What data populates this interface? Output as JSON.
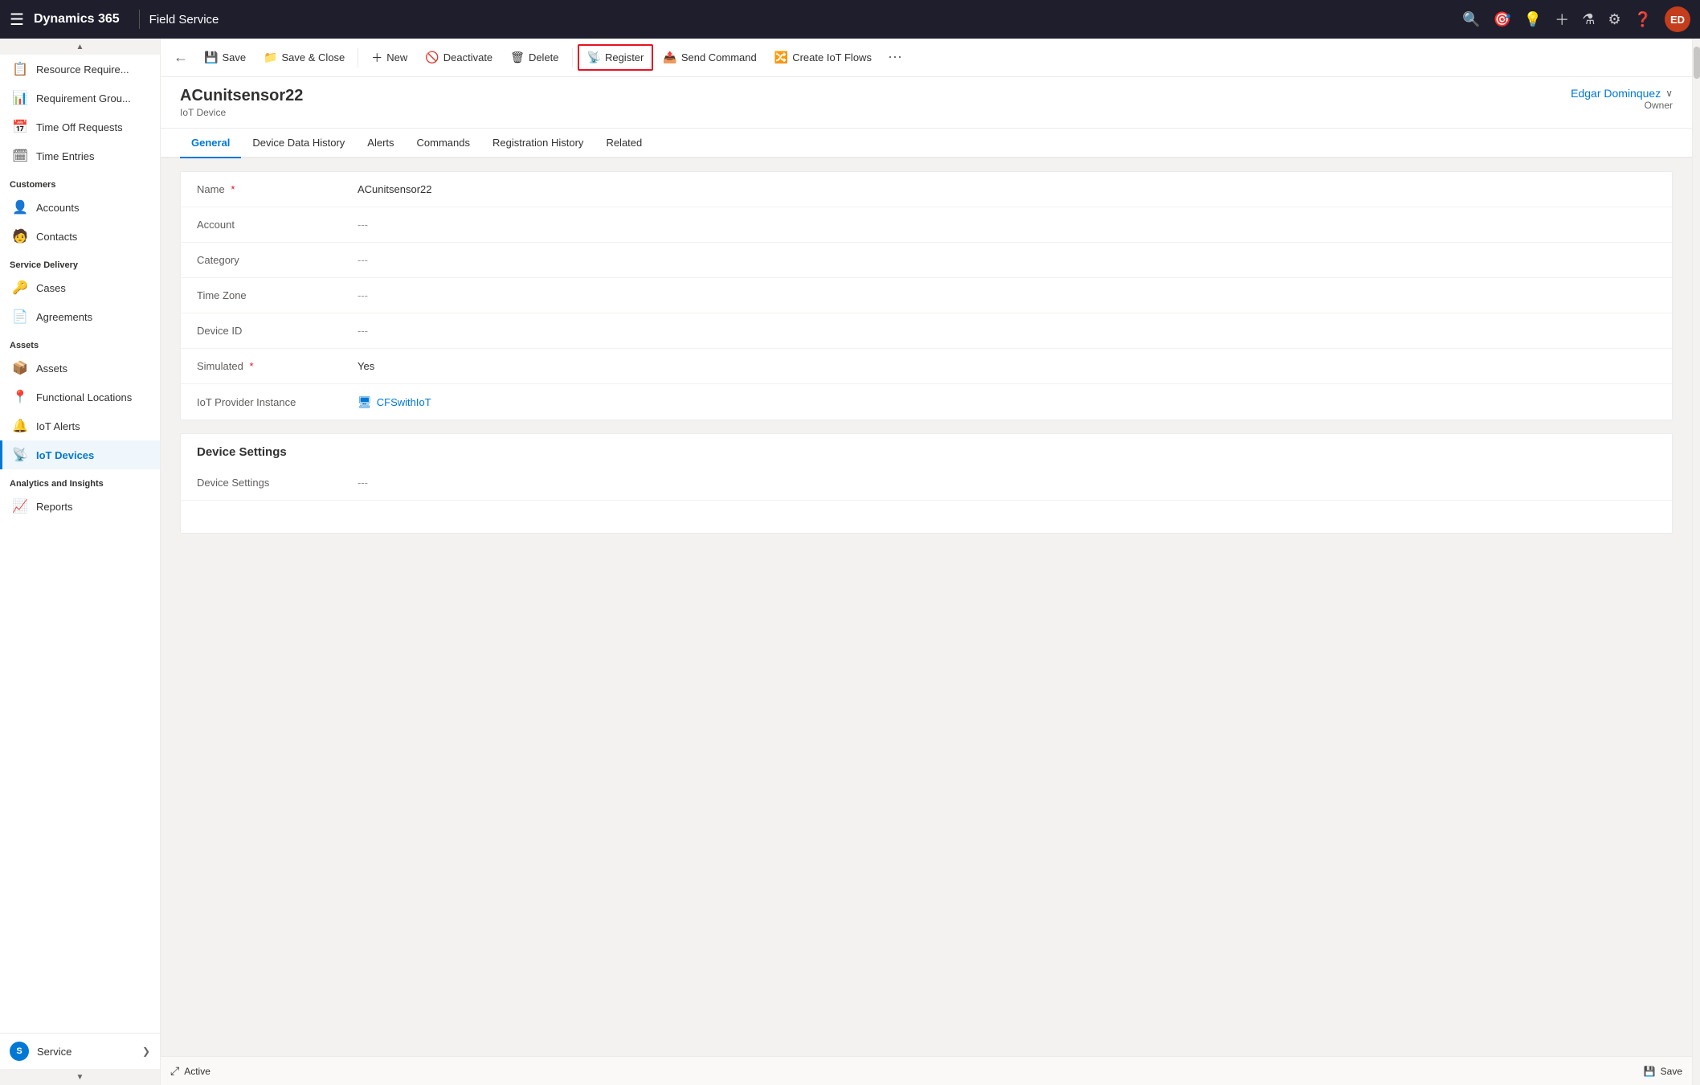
{
  "topNav": {
    "brand": "Dynamics 365",
    "divider": "|",
    "app": "Field Service",
    "avatar": "ED"
  },
  "toolbar": {
    "back_label": "←",
    "save_label": "Save",
    "save_close_label": "Save & Close",
    "new_label": "New",
    "deactivate_label": "Deactivate",
    "delete_label": "Delete",
    "register_label": "Register",
    "send_command_label": "Send Command",
    "create_iot_flows_label": "Create IoT Flows"
  },
  "record": {
    "title": "ACunitsensor22",
    "subtitle": "IoT Device",
    "owner_name": "Edgar Dominquez",
    "owner_label": "Owner"
  },
  "tabs": [
    {
      "label": "General",
      "active": true
    },
    {
      "label": "Device Data History",
      "active": false
    },
    {
      "label": "Alerts",
      "active": false
    },
    {
      "label": "Commands",
      "active": false
    },
    {
      "label": "Registration History",
      "active": false
    },
    {
      "label": "Related",
      "active": false
    }
  ],
  "form": {
    "fields": [
      {
        "label": "Name",
        "required": true,
        "value": "ACunitsensor22",
        "empty": false,
        "link": false
      },
      {
        "label": "Account",
        "required": false,
        "value": "---",
        "empty": true,
        "link": false
      },
      {
        "label": "Category",
        "required": false,
        "value": "---",
        "empty": true,
        "link": false
      },
      {
        "label": "Time Zone",
        "required": false,
        "value": "---",
        "empty": true,
        "link": false
      },
      {
        "label": "Device ID",
        "required": false,
        "value": "---",
        "empty": true,
        "link": false
      },
      {
        "label": "Simulated",
        "required": true,
        "value": "Yes",
        "empty": false,
        "link": false
      },
      {
        "label": "IoT Provider Instance",
        "required": false,
        "value": "CFSwithIoT",
        "empty": false,
        "link": true
      }
    ],
    "deviceSettings": {
      "section_title": "Device Settings",
      "field_label": "Device Settings",
      "field_value": "---"
    }
  },
  "sidebar": {
    "sections": [
      {
        "label": "",
        "items": [
          {
            "id": "resource-req",
            "icon": "📋",
            "label": "Resource Require..."
          },
          {
            "id": "requirement-group",
            "icon": "📊",
            "label": "Requirement Grou..."
          },
          {
            "id": "time-off-requests",
            "icon": "📅",
            "label": "Time Off Requests"
          },
          {
            "id": "time-entries",
            "icon": "🗓",
            "label": "Time Entries"
          }
        ]
      },
      {
        "label": "Customers",
        "items": [
          {
            "id": "accounts",
            "icon": "👤",
            "label": "Accounts"
          },
          {
            "id": "contacts",
            "icon": "🧑",
            "label": "Contacts"
          }
        ]
      },
      {
        "label": "Service Delivery",
        "items": [
          {
            "id": "cases",
            "icon": "🔑",
            "label": "Cases"
          },
          {
            "id": "agreements",
            "icon": "📄",
            "label": "Agreements"
          }
        ]
      },
      {
        "label": "Assets",
        "items": [
          {
            "id": "assets",
            "icon": "📦",
            "label": "Assets"
          },
          {
            "id": "functional-locations",
            "icon": "📍",
            "label": "Functional Locations"
          },
          {
            "id": "iot-alerts",
            "icon": "🔔",
            "label": "IoT Alerts"
          },
          {
            "id": "iot-devices",
            "icon": "📡",
            "label": "IoT Devices",
            "active": true
          }
        ]
      },
      {
        "label": "Analytics and Insights",
        "items": [
          {
            "id": "reports",
            "icon": "📈",
            "label": "Reports"
          }
        ]
      },
      {
        "label": "",
        "items": [
          {
            "id": "service",
            "icon": "⚙",
            "label": "Service"
          }
        ]
      }
    ],
    "bottom": {
      "label": "S",
      "text": "Service"
    }
  },
  "statusBar": {
    "icon": "⤢",
    "status": "Active",
    "save_icon": "💾",
    "save_label": "Save"
  },
  "colors": {
    "active_blue": "#0078d4",
    "register_red": "#e81123",
    "brand_dark": "#1e1e2d"
  }
}
